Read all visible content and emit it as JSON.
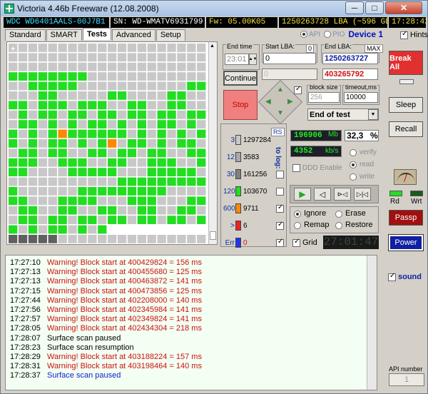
{
  "window": {
    "title": "Victoria 4.46b Freeware (12.08.2008)",
    "min": "─",
    "max": "□",
    "close": "✕"
  },
  "infobar": {
    "model": "WDC WD6401AALS-00J7B1",
    "serial": "SN: WD-WMATV6931799",
    "firmware": "Fw: 05.00K05",
    "lba": "1250263728 LBA (~596 GB)",
    "time": "17:28:42"
  },
  "tabs": [
    "Standard",
    "SMART",
    "Tests",
    "Advanced",
    "Setup"
  ],
  "mode": {
    "api": "API",
    "pio": "PIO",
    "device": "Device 1",
    "hints": "Hints"
  },
  "params": {
    "end_time_label": "End time",
    "end_time_value": "23:01",
    "start_lba_label": "Start LBA:",
    "start_lba_zero": "0",
    "start_lba_value": "0",
    "end_lba_label": "End LBA:",
    "end_lba_max": "MAX",
    "end_lba_value": "1250263727",
    "current_lba_value": "403265792",
    "continue_label": "Continue",
    "stop_label": "Stop",
    "block_size_label": "block size",
    "block_size_value": "256",
    "timeout_label": "timeout,ms",
    "timeout_value": "10000",
    "end_action": "End of test"
  },
  "stats": {
    "rs": "RS",
    "to_log": "to log:",
    "rows": [
      {
        "threshold": "3",
        "count": "1297284",
        "color": "#c8c8c8"
      },
      {
        "threshold": "12",
        "count": "3583",
        "color": "#a8a8a8"
      },
      {
        "threshold": "30",
        "count": "161256",
        "color": "#808080"
      },
      {
        "threshold": "120",
        "count": "103670",
        "color": "#22dd22"
      },
      {
        "threshold": "600",
        "count": "9711",
        "color": "#ff8800"
      },
      {
        "threshold": ">",
        "count": "6",
        "color": "#ee2222"
      },
      {
        "threshold": "Err",
        "count": "0",
        "color": "#2233ee"
      }
    ]
  },
  "speed": {
    "scanned": "196906",
    "scanned_unit": "Mb",
    "percent": "32,3",
    "percent_unit": "%",
    "rate": "4352",
    "rate_unit": "kb/s",
    "ddd": "DDD Enable",
    "verify": "verify",
    "read": "read",
    "write": "write"
  },
  "actions": {
    "ignore": "Ignore",
    "erase": "Erase",
    "remap": "Remap",
    "restore": "Restore",
    "grid": "Grid",
    "timer": "27:01:47"
  },
  "right": {
    "break_all": "Break All",
    "sleep": "Sleep",
    "recall": "Recall",
    "rd": "Rd",
    "wrt": "Wrt",
    "passp": "Passp",
    "power": "Power",
    "sound": "sound",
    "api_number_label": "API number",
    "api_number": "1"
  },
  "log": [
    {
      "time": "17:27:10",
      "text": "Warning! Block start at 400429824 = 156 ms",
      "color": "#d01010"
    },
    {
      "time": "17:27:13",
      "text": "Warning! Block start at 400455680 = 125 ms",
      "color": "#d01010"
    },
    {
      "time": "17:27:13",
      "text": "Warning! Block start at 400463872 = 141 ms",
      "color": "#d01010"
    },
    {
      "time": "17:27:15",
      "text": "Warning! Block start at 400473856 = 125 ms",
      "color": "#d01010"
    },
    {
      "time": "17:27:44",
      "text": "Warning! Block start at 402208000 = 140 ms",
      "color": "#d01010"
    },
    {
      "time": "17:27:56",
      "text": "Warning! Block start at 402345984 = 141 ms",
      "color": "#d01010"
    },
    {
      "time": "17:27:57",
      "text": "Warning! Block start at 402349824 = 141 ms",
      "color": "#d01010"
    },
    {
      "time": "17:28:05",
      "text": "Warning! Block start at 402434304 = 218 ms",
      "color": "#d01010"
    },
    {
      "time": "17:28:07",
      "text": "Surface scan paused",
      "color": "#000000"
    },
    {
      "time": "17:28:23",
      "text": "Surface scan resumption",
      "color": "#000000"
    },
    {
      "time": "17:28:29",
      "text": "Warning! Block start at 403188224 = 157 ms",
      "color": "#d01010"
    },
    {
      "time": "17:28:31",
      "text": "Warning! Block start at 403198464 = 140 ms",
      "color": "#d01010"
    },
    {
      "time": "17:28:37",
      "text": "Surface scan paused",
      "color": "#1020d0"
    }
  ],
  "colors": {
    "grey": "#c8c8c8",
    "green": "#22dd22",
    "orange": "#ff8800",
    "dark": "#606060",
    "empty": "#ffffff"
  }
}
